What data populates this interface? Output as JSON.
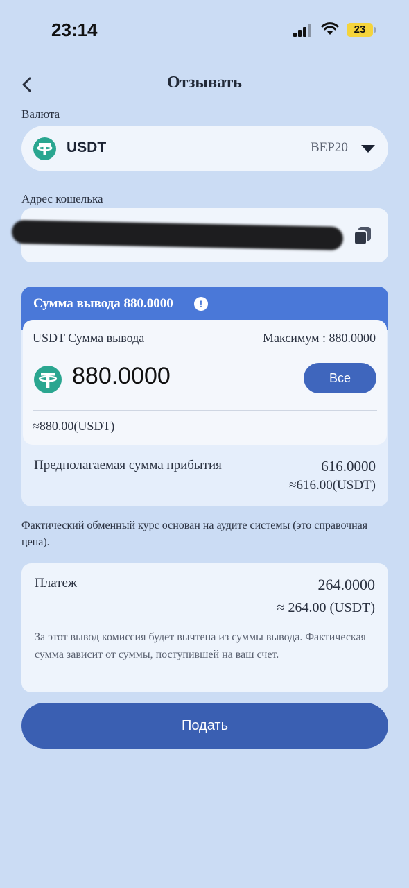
{
  "status_bar": {
    "time": "23:14",
    "battery": "23",
    "battery_color": "#f5d43b"
  },
  "header": {
    "title": "Отзывать",
    "back_icon": "chevron-left-icon"
  },
  "currency": {
    "label": "Валюта",
    "name": "USDT",
    "network": "BEP20",
    "icon": "tether-icon"
  },
  "wallet": {
    "label": "Адрес кошелька",
    "copy_icon": "copy-icon"
  },
  "amount": {
    "header": "Сумма вывода 880.0000",
    "input_label": "USDT Сумма вывода",
    "max": "Максимум : 880.0000",
    "value": "880.0000",
    "all_button": "Все",
    "approx": "≈880.00(USDT)",
    "arrival_label": "Предполагаемая сумма прибытия",
    "arrival_value": "616.0000",
    "arrival_approx": "≈616.00(USDT)"
  },
  "rate_note": "Фактический обменный курс основан на аудите системы (это справочная цена).",
  "fee": {
    "label": "Платеж",
    "value": "264.0000",
    "approx": "≈ 264.00 (USDT)",
    "note": "За этот вывод комиссия будет вычтена из суммы вывода. Фактическая сумма зависит от суммы, поступившей на ваш счет."
  },
  "submit_label": "Подать",
  "colors": {
    "background": "#cbdcf4",
    "accent": "#4a78d8",
    "button": "#3a5fb2",
    "tether": "#2aa690"
  }
}
